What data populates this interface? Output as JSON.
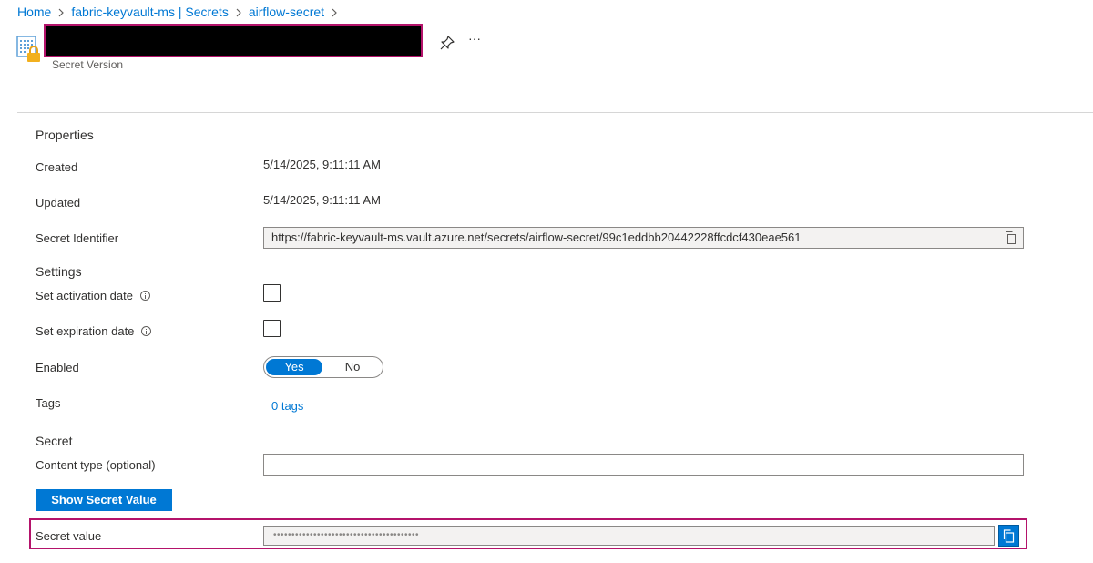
{
  "breadcrumb": {
    "home": "Home",
    "vault": "fabric-keyvault-ms | Secrets",
    "secret": "airflow-secret"
  },
  "header": {
    "title": "",
    "subtitle": "Secret Version",
    "pin_icon": "pin-icon",
    "more_label": "···"
  },
  "properties": {
    "heading": "Properties",
    "created_label": "Created",
    "created_value": "5/14/2025, 9:11:11 AM",
    "updated_label": "Updated",
    "updated_value": "5/14/2025, 9:11:11 AM",
    "identifier_label": "Secret Identifier",
    "identifier_value": "https://fabric-keyvault-ms.vault.azure.net/secrets/airflow-secret/99c1eddbb20442228ffcdcf430eae561"
  },
  "settings": {
    "heading": "Settings",
    "activation_label": "Set activation date",
    "activation_checked": false,
    "expiration_label": "Set expiration date",
    "expiration_checked": false,
    "enabled_label": "Enabled",
    "enabled_yes": "Yes",
    "enabled_no": "No",
    "enabled_selected": "Yes",
    "tags_label": "Tags",
    "tags_value": "0 tags"
  },
  "secret": {
    "heading": "Secret",
    "content_type_label": "Content type (optional)",
    "content_type_value": "",
    "show_button": "Show Secret Value",
    "value_label": "Secret value",
    "masked_value": "••••••••••••••••••••••••••••••••••••••••"
  },
  "colors": {
    "accent": "#0078d4",
    "highlight_border": "#b4136b"
  }
}
